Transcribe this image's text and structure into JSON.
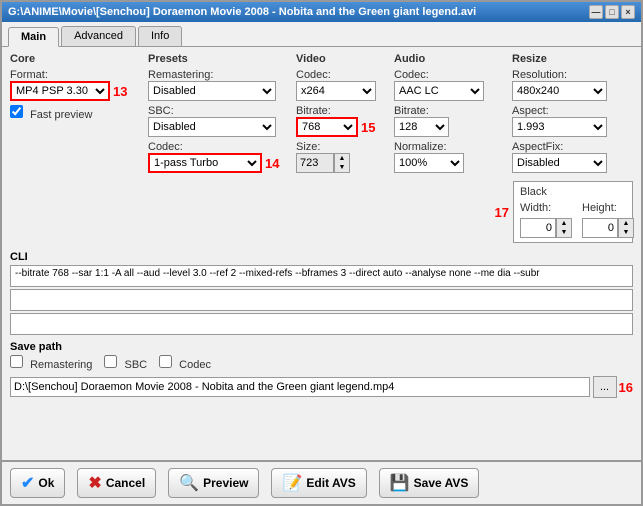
{
  "window": {
    "title": "G:\\ANIME\\Movie\\[Senchou] Doraemon Movie 2008 - Nobita and the Green giant legend.avi",
    "close": "×",
    "minimize": "—",
    "maximize": "□"
  },
  "tabs": {
    "main": "Main",
    "advanced": "Advanced",
    "info": "Info"
  },
  "core": {
    "label": "Core",
    "format_label": "Format:",
    "format_value": "MP4 PSP 3.30",
    "format_options": [
      "MP4 PSP 3.30"
    ],
    "fast_preview": "Fast preview",
    "badge": "13"
  },
  "presets": {
    "label": "Presets",
    "remastering_label": "Remastering:",
    "remastering_value": "Disabled",
    "sbc_label": "SBC:",
    "sbc_value": "Disabled",
    "codec_label": "Codec:",
    "codec_value": "1-pass Turbo",
    "badge": "14"
  },
  "video": {
    "label": "Video",
    "codec_label": "Codec:",
    "codec_value": "x264",
    "bitrate_label": "Bitrate:",
    "bitrate_value": "768",
    "size_label": "Size:",
    "size_value": "723",
    "badge": "15"
  },
  "audio": {
    "label": "Audio",
    "codec_label": "Codec:",
    "codec_value": "AAC LC",
    "bitrate_label": "Bitrate:",
    "bitrate_value": "128",
    "normalize_label": "Normalize:",
    "normalize_value": "100%"
  },
  "resize": {
    "label": "Resize",
    "resolution_label": "Resolution:",
    "resolution_value": "480x240",
    "aspect_label": "Aspect:",
    "aspect_value": "1.993",
    "aspectfix_label": "AspectFix:",
    "aspectfix_value": "Disabled"
  },
  "black": {
    "title": "Black",
    "width_label": "Width:",
    "width_value": "0",
    "height_label": "Height:",
    "height_value": "0",
    "badge": "17"
  },
  "cli": {
    "label": "CLI",
    "text": "--bitrate 768 --sar 1:1 -A all --aud --level 3.0 --ref 2 --mixed-refs --bframes 3 --direct auto --analyse none --me dia --subr"
  },
  "save_path": {
    "label": "Save path",
    "remastering": "Remastering",
    "sbc": "SBC",
    "codec": "Codec",
    "path_value": "D:\\[Senchou] Doraemon Movie 2008 - Nobita and the Green giant legend.mp4",
    "browse": "...",
    "badge": "16"
  },
  "bottom": {
    "ok": "Ok",
    "cancel": "Cancel",
    "preview": "Preview",
    "edit_avs": "Edit AVS",
    "save_avs": "Save AVS"
  }
}
